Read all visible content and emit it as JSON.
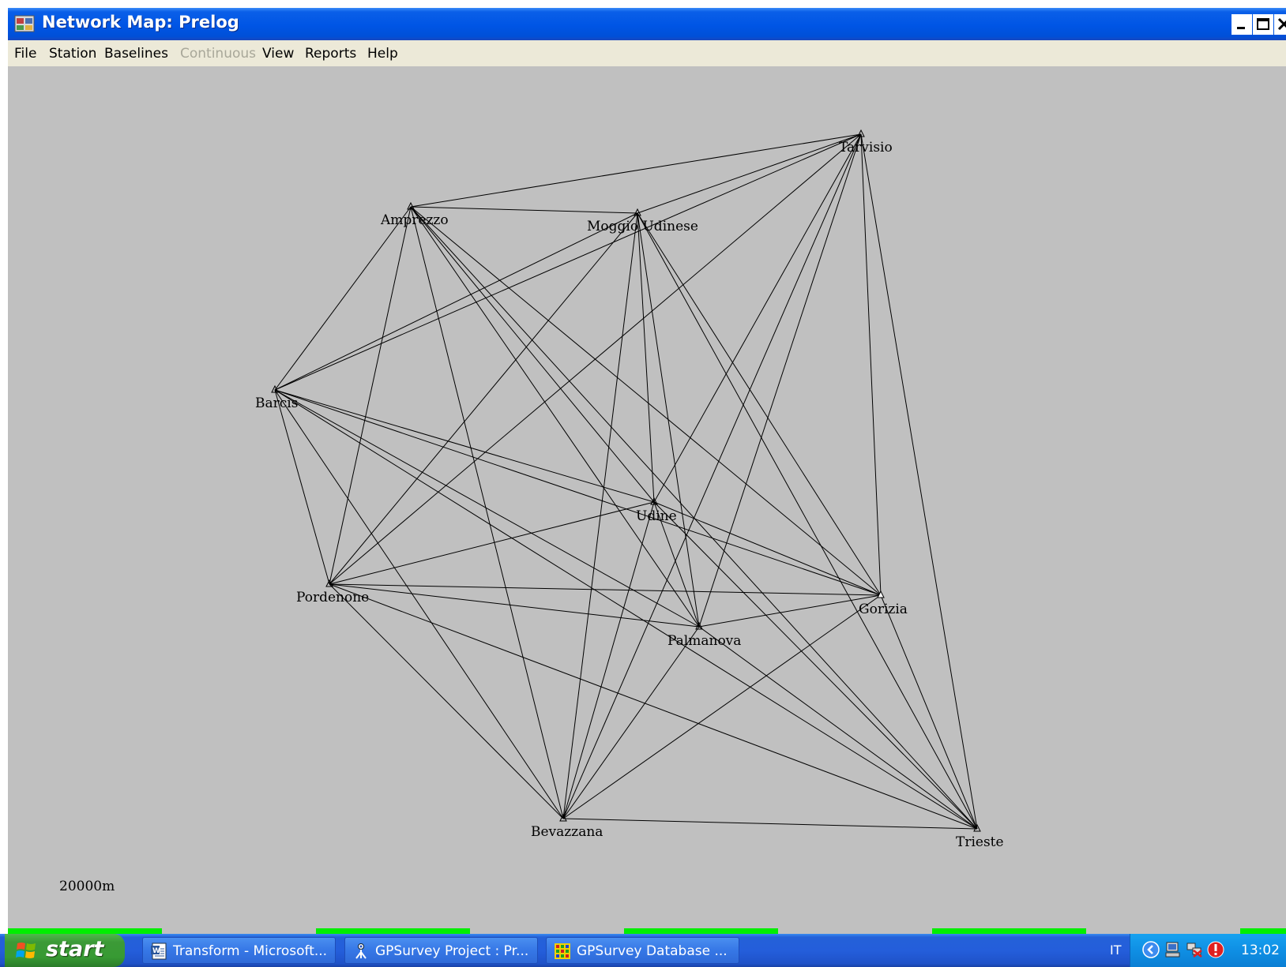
{
  "window": {
    "title": "Network Map: Prelog"
  },
  "menu": {
    "items": [
      {
        "label": "File",
        "enabled": true
      },
      {
        "label": "Station",
        "enabled": true
      },
      {
        "label": "Baselines",
        "enabled": true
      },
      {
        "label": "Continuous",
        "enabled": false
      },
      {
        "label": "View",
        "enabled": true
      },
      {
        "label": "Reports",
        "enabled": true
      },
      {
        "label": "Help",
        "enabled": true
      }
    ]
  },
  "map": {
    "stations": [
      {
        "name": "Tarvisio"
      },
      {
        "name": "Amprezzo"
      },
      {
        "name": "Moggio Udinese"
      },
      {
        "name": "Barcis"
      },
      {
        "name": "Udine"
      },
      {
        "name": "Pordenone"
      },
      {
        "name": "Gorizia"
      },
      {
        "name": "Palmanova"
      },
      {
        "name": "Bevazzana"
      },
      {
        "name": "Trieste"
      }
    ],
    "scale_label": "20000m"
  },
  "taskbar": {
    "start_label": "start",
    "tasks": [
      {
        "label": "Transform - Microsoft...",
        "icon": "word-document-icon",
        "active": false
      },
      {
        "label": "GPSurvey Project : Pr...",
        "icon": "gpsurvey-project-icon",
        "active": false
      },
      {
        "label": "GPSurvey Database ...",
        "icon": "gpsurvey-database-icon",
        "active": false
      }
    ],
    "language": "IT",
    "clock": "13:02"
  },
  "colors": {
    "title_bar": "#0055e5",
    "menu_bar": "#ece9d8",
    "map_background": "#c0c0c0",
    "baseline": "#000000",
    "progress": "#00ee00",
    "taskbar": "#245edb",
    "start_button": "#379a33"
  }
}
